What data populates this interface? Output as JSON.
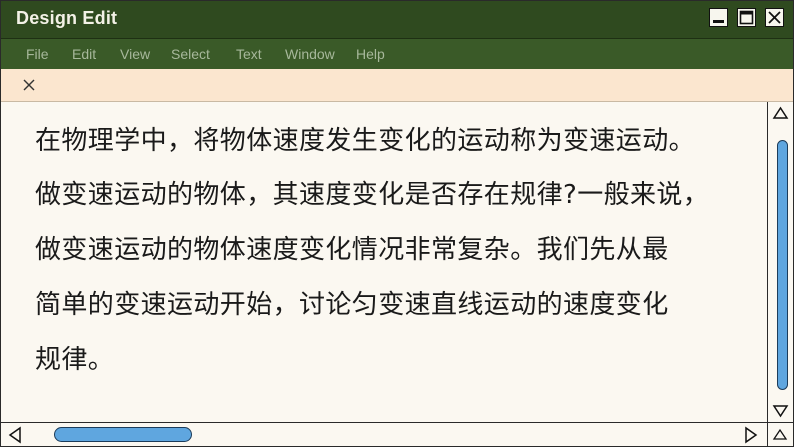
{
  "window": {
    "title": "Design Edit"
  },
  "menu": {
    "items": [
      "File",
      "Edit",
      "View",
      "Select",
      "Text",
      "Window",
      "Help"
    ]
  },
  "document": {
    "lines": [
      "在物理学中，将物体速度发生变化的运动称为变速运动。",
      "做变速运动的物体，其速度变化是否存在规律?一般来说，",
      "做变速运动的物体速度变化情况非常复杂。我们先从最",
      "简单的变速运动开始，讨论匀变速直线运动的速度变化",
      "规律。"
    ]
  },
  "icons": {
    "minimize": "minimize-icon",
    "maximize": "maximize-icon",
    "close": "close-icon",
    "tab_close": "close-icon",
    "scroll_up": "triangle-up-icon",
    "scroll_down": "triangle-down-icon",
    "scroll_left": "triangle-left-icon",
    "scroll_right": "triangle-right-icon"
  },
  "colors": {
    "titlebar": "#2f4a1f",
    "menubar": "#3a5a28",
    "tabbar": "#fbe6cf",
    "scroll_thumb": "#5fa6df",
    "document_bg": "#fbf8f1"
  }
}
